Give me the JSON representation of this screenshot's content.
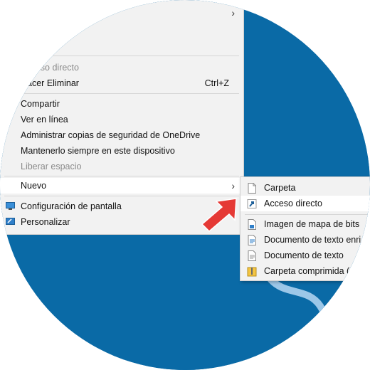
{
  "colors": {
    "desktop": "#0a6aa6",
    "menu_bg": "#f2f2f2",
    "highlight": "#ffffff",
    "disabled_text": "#8a8a8a",
    "arrow": "#e53935"
  },
  "context_menu": {
    "items": [
      {
        "label": "Acceso directo",
        "disabled": true
      },
      {
        "label": "Hacer Eliminar",
        "shortcut": "Ctrl+Z"
      },
      {
        "label": "Compartir"
      },
      {
        "label": "Ver en línea"
      },
      {
        "label": "Administrar copias de seguridad de OneDrive"
      },
      {
        "label": "Mantenerlo siempre en este dispositivo"
      },
      {
        "label": "Liberar espacio",
        "disabled": true
      },
      {
        "label": "Nuevo",
        "submenu": true
      },
      {
        "label": "Configuración de pantalla",
        "icon": "display-settings-icon"
      },
      {
        "label": "Personalizar",
        "icon": "personalize-icon"
      }
    ]
  },
  "submenu": {
    "items": [
      {
        "label": "Carpeta",
        "icon": "folder-file-icon"
      },
      {
        "label": "Acceso directo",
        "icon": "shortcut-icon"
      },
      {
        "label": "Imagen de mapa de bits",
        "icon": "bitmap-image-icon"
      },
      {
        "label": "Documento de texto enri",
        "icon": "rich-text-document-icon"
      },
      {
        "label": "Documento de texto",
        "icon": "text-document-icon"
      },
      {
        "label": "Carpeta comprimida (",
        "icon": "zip-folder-icon"
      }
    ]
  }
}
